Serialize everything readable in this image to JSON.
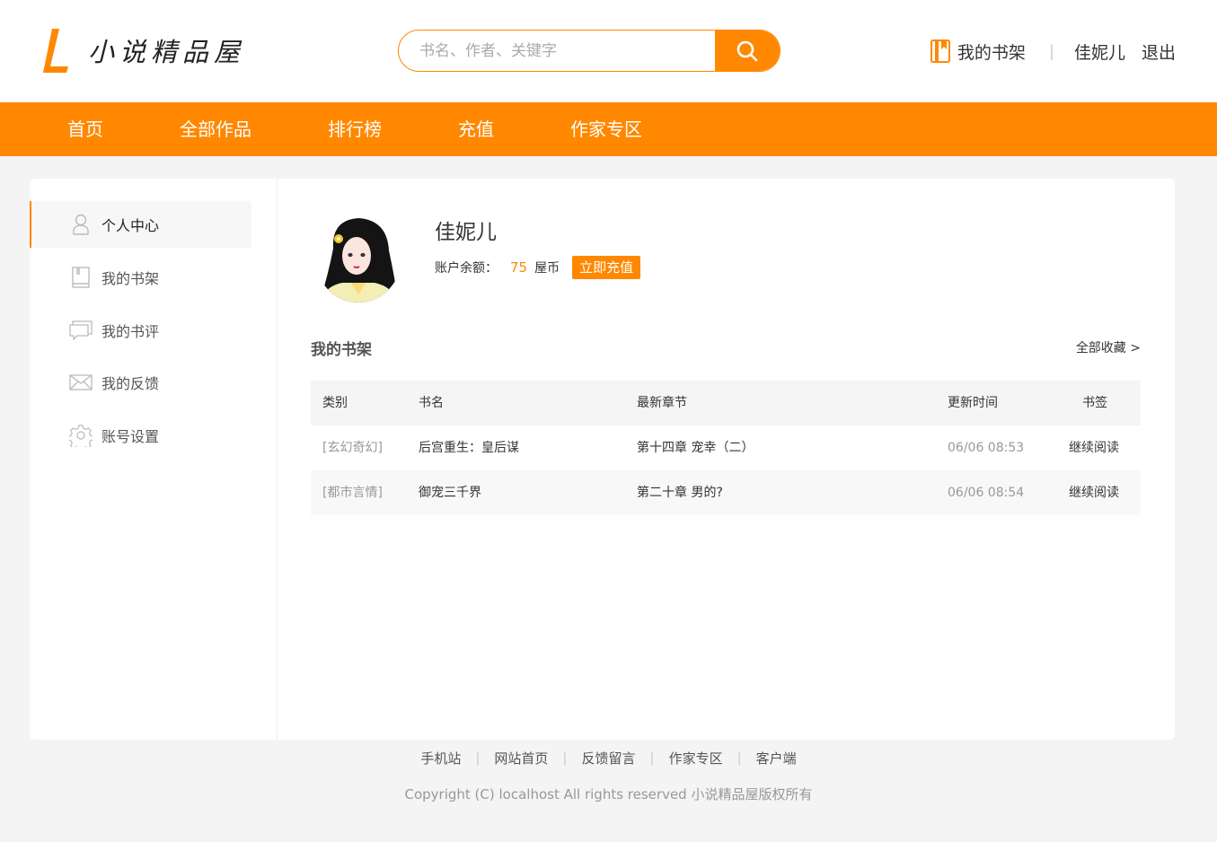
{
  "site": {
    "logo_text": "小说精品屋",
    "accent_color": "#ff8800"
  },
  "search": {
    "placeholder": "书名、作者、关键字",
    "button_icon": "search-icon"
  },
  "top_bar": {
    "shelf_label": "我的书架",
    "shelf_icon": "bookshelf-icon",
    "separator": "|",
    "username": "佳妮儿",
    "logout_label": "退出"
  },
  "nav": {
    "items": [
      {
        "label": "首页"
      },
      {
        "label": "全部作品"
      },
      {
        "label": "排行榜"
      },
      {
        "label": "充值"
      },
      {
        "label": "作家专区"
      }
    ]
  },
  "sidebar": {
    "items": [
      {
        "label": "个人中心",
        "icon": "user-icon",
        "active": true
      },
      {
        "label": "我的书架",
        "icon": "book-icon",
        "active": false
      },
      {
        "label": "我的书评",
        "icon": "comment-icon",
        "active": false
      },
      {
        "label": "我的反馈",
        "icon": "mail-icon",
        "active": false
      },
      {
        "label": "账号设置",
        "icon": "gear-icon",
        "active": false
      }
    ]
  },
  "profile": {
    "username": "佳妮儿",
    "balance_label": "账户余额：",
    "balance_amount": "75",
    "balance_unit": "屋币",
    "recharge_label": "立即充值"
  },
  "shelf": {
    "title": "我的书架",
    "more_label": "全部收藏 >",
    "columns": {
      "category": "类别",
      "name": "书名",
      "chapter": "最新章节",
      "time": "更新时间",
      "bookmark": "书签"
    },
    "rows": [
      {
        "category": "[玄幻奇幻]",
        "name": "后宫重生：皇后谋",
        "chapter": "第十四章 宠幸（二）",
        "time": "06/06 08:53",
        "bookmark": "继续阅读"
      },
      {
        "category": "[都市言情]",
        "name": "御宠三千界",
        "chapter": "第二十章 男的?",
        "time": "06/06 08:54",
        "bookmark": "继续阅读"
      }
    ]
  },
  "footer": {
    "links": [
      {
        "label": "手机站"
      },
      {
        "label": "网站首页"
      },
      {
        "label": "反馈留言"
      },
      {
        "label": "作家专区"
      },
      {
        "label": "客户端"
      }
    ],
    "separator": "|",
    "copyright": "Copyright (C) localhost All rights reserved 小说精品屋版权所有"
  }
}
